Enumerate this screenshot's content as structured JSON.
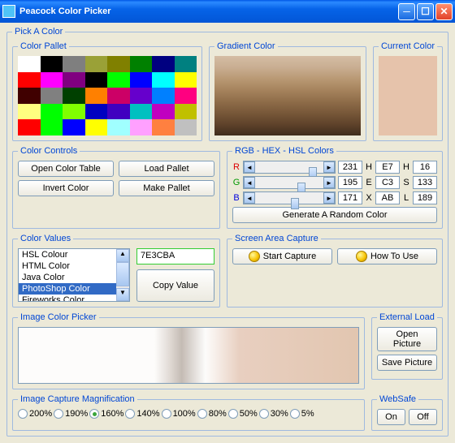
{
  "window": {
    "title": "Peacock Color Picker"
  },
  "outer_legend": "Pick A Color",
  "palette": {
    "legend": "Color Pallet",
    "colors": [
      "#ffffff",
      "#000000",
      "#7f7f7f",
      "#9aa137",
      "#808000",
      "#008000",
      "#000080",
      "#008080",
      "#ff0000",
      "#ff00ff",
      "#800080",
      "#000000",
      "#00ff00",
      "#0000ff",
      "#00ffff",
      "#ffff00",
      "#400000",
      "#808080",
      "#004000",
      "#ff8000",
      "#cc0066",
      "#6600cc",
      "#0080ff",
      "#ff0080",
      "#ffff80",
      "#00ff00",
      "#80ff00",
      "#0000c0",
      "#4000c0",
      "#00c0c0",
      "#c000c0",
      "#c0c000",
      "#ff0000",
      "#00ff00",
      "#0000ff",
      "#ffff00",
      "#a0ffff",
      "#ffa0ff",
      "#ff8040",
      "#c0c0c0"
    ]
  },
  "gradient": {
    "legend": "Gradient Color"
  },
  "current": {
    "legend": "Current Color",
    "hex": "#e6c3ab"
  },
  "controls": {
    "legend": "Color Controls",
    "open_table": "Open Color Table",
    "load_pallet": "Load Pallet",
    "invert": "Invert Color",
    "make_pallet": "Make Pallet"
  },
  "rgb": {
    "legend": "RGB - HEX - HSL Colors",
    "r_label": "R",
    "g_label": "G",
    "b_label": "B",
    "h1_label": "H",
    "e_label": "E",
    "x_label": "X",
    "h2_label": "H",
    "s_label": "S",
    "l_label": "L",
    "r": "231",
    "g": "195",
    "b": "171",
    "hexH": "E7",
    "hexE": "C3",
    "hexX": "AB",
    "hslH": "16",
    "hslS": "133",
    "hslL": "189",
    "random": "Generate A Random Color"
  },
  "values": {
    "legend": "Color Values",
    "items": [
      "HSL Colour",
      "HTML Color",
      "Java Color",
      "PhotoShop Color",
      "Fireworks Color"
    ],
    "selected": 3,
    "hex_value": "7E3CBA",
    "copy": "Copy Value"
  },
  "capture": {
    "legend": "Screen Area Capture",
    "start": "Start Capture",
    "howto": "How To Use"
  },
  "image_picker": {
    "legend": "Image Color Picker"
  },
  "external": {
    "legend": "External Load",
    "open": "Open Picture",
    "save": "Save Picture"
  },
  "mag": {
    "legend": "Image Capture Magnification",
    "options": [
      "200%",
      "190%",
      "160%",
      "140%",
      "100%",
      "80%",
      "50%",
      "30%",
      "5%"
    ],
    "selected": 2
  },
  "websafe": {
    "legend": "WebSafe",
    "on": "On",
    "off": "Off"
  }
}
